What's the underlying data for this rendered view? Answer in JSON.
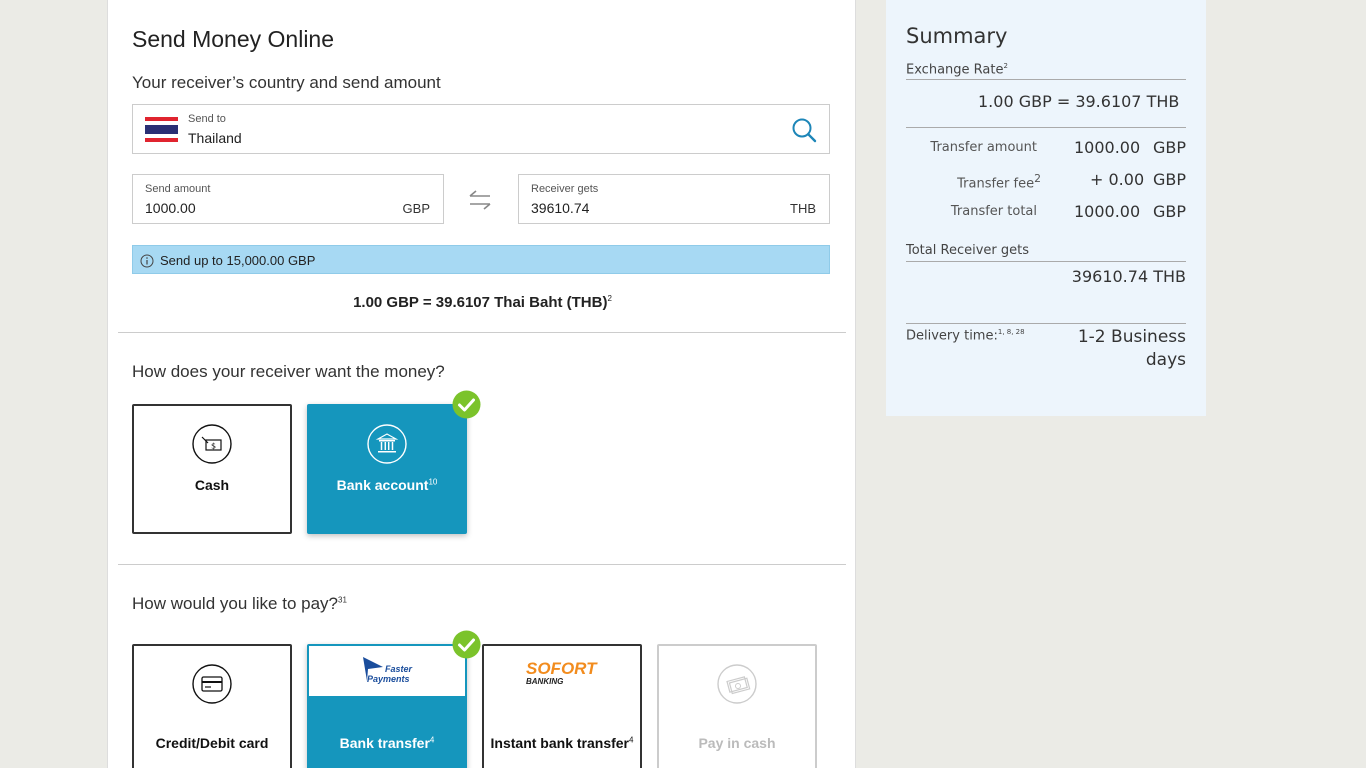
{
  "main": {
    "title": "Send Money Online",
    "subtitle": "Your receiver’s country and send amount",
    "send_to": {
      "label": "Send to",
      "value": "Thailand"
    },
    "send_amount": {
      "label": "Send amount",
      "value": "1000.00",
      "currency": "GBP"
    },
    "receiver_gets": {
      "label": "Receiver gets",
      "value": "39610.74",
      "currency": "THB"
    },
    "info_banner": "Send up to 15,000.00 GBP",
    "rate_line": "1.00 GBP = 39.6107 Thai Baht (THB)",
    "rate_line_sup": "2",
    "receive_question": "How does your receiver want the money?",
    "receive_options": [
      {
        "label": "Cash",
        "sup": "",
        "icon": "cash-hand-icon",
        "selected": false
      },
      {
        "label": "Bank account",
        "sup": "10",
        "icon": "bank-icon",
        "selected": true
      }
    ],
    "pay_question": "How would you like to pay?",
    "pay_question_sup": "31",
    "pay_options": [
      {
        "label": "Credit/Debit card",
        "sup": "",
        "icon": "credit-card-icon",
        "selected": false,
        "disabled": false
      },
      {
        "label": "Bank transfer",
        "sup": "4",
        "logo_text_1": "Faster",
        "logo_text_2": "Payments",
        "selected": true,
        "disabled": false
      },
      {
        "label": "Instant bank transfer",
        "sup": "4",
        "logo_text_1": "SOFORT",
        "logo_text_2": "BANKING",
        "selected": false,
        "disabled": false
      },
      {
        "label": "Pay in cash",
        "sup": "",
        "icon": "cash-bills-icon",
        "selected": false,
        "disabled": true
      }
    ]
  },
  "summary": {
    "title": "Summary",
    "exchange_rate_label": "Exchange Rate",
    "exchange_rate_sup": "2",
    "exchange_rate_value": "1.00 GBP = 39.6107 THB",
    "transfer_amount_label": "Transfer amount",
    "transfer_amount_value": "1000.00",
    "transfer_fee_label": "Transfer fee",
    "transfer_fee_sup": "2",
    "transfer_fee_value": "+ 0.00",
    "transfer_total_label": "Transfer total",
    "transfer_total_value": "1000.00",
    "currency": "GBP",
    "total_receiver_label": "Total Receiver gets",
    "total_receiver_value": "39610.74 THB",
    "delivery_label": "Delivery time:",
    "delivery_sup": "1, 8, 28",
    "delivery_value_1": "1-2 Business",
    "delivery_value_2": "days"
  },
  "colors": {
    "accent": "#1596bd",
    "info_bg": "#a7d9f3",
    "check": "#7bc32b",
    "summary_bg": "#edf5fc",
    "page_bg": "#ebebe6"
  }
}
